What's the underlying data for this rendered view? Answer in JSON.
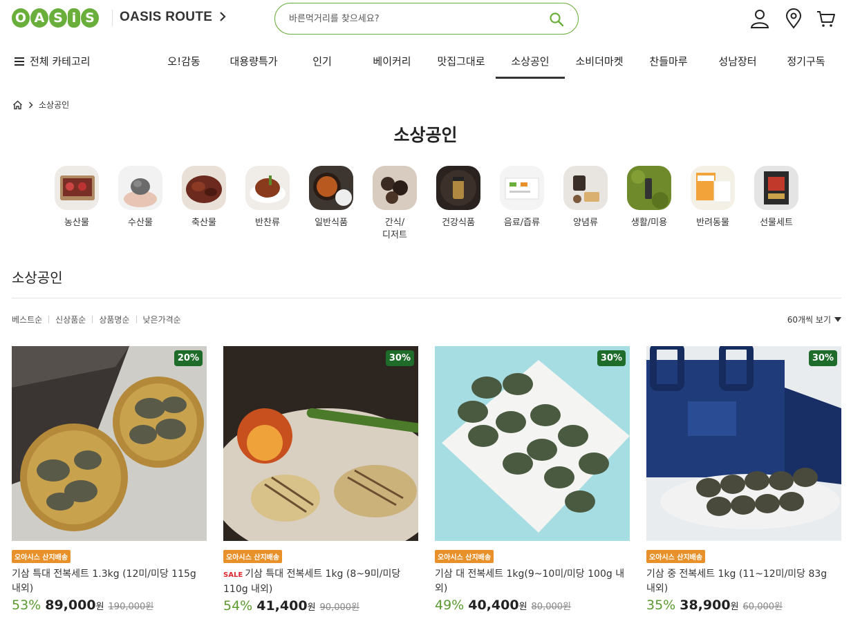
{
  "header": {
    "logo_letters": [
      "O",
      "A",
      "S",
      "i",
      "S"
    ],
    "route_label": "OASIS ROUTE",
    "search_placeholder": "바른먹거리를 찾으세요?"
  },
  "colors": {
    "brand_green": "#6aae3c",
    "badge_green": "#1e6b2a",
    "ship_orange": "#e8912a",
    "sale_red": "#e0262e"
  },
  "nav": {
    "all_categories": "전체 카테고리",
    "items": [
      "오!감동",
      "대용량특가",
      "인기",
      "베이커리",
      "맛집그대로",
      "소상공인",
      "소비더마켓",
      "찬들마루",
      "성남장터",
      "정기구독"
    ],
    "active": "소상공인"
  },
  "breadcrumb": {
    "current": "소상공인"
  },
  "page_title": "소상공인",
  "categories": [
    "농산물",
    "수산물",
    "축산물",
    "반찬류",
    "일반식품",
    "간식/\n디저트",
    "건강식품",
    "음료/즙류",
    "양념류",
    "생활/미용",
    "반려동물",
    "선물세트"
  ],
  "section_title": "소상공인",
  "sorts": [
    "베스트순",
    "신상품순",
    "상품명순",
    "낮은가격순"
  ],
  "per_page": "60개씩 보기",
  "products": [
    {
      "badge": "20%",
      "ship": "오아시스 산지배송",
      "sale": "",
      "name": "기삼 특대 전복세트 1.3kg (12미/미당 115g 내외)",
      "rate": "53%",
      "price": "89,000",
      "won": "원",
      "orig": "190,000원"
    },
    {
      "badge": "30%",
      "ship": "오아시스 산지배송",
      "sale": "SALE",
      "name": "기삼 특대 전복세트 1kg (8~9미/미당 110g 내외)",
      "rate": "54%",
      "price": "41,400",
      "won": "원",
      "orig": "90,000원"
    },
    {
      "badge": "30%",
      "ship": "오아시스 산지배송",
      "sale": "",
      "name": "기삼 대 전복세트 1kg(9~10미/미당 100g 내외)",
      "rate": "49%",
      "price": "40,400",
      "won": "원",
      "orig": "80,000원"
    },
    {
      "badge": "30%",
      "ship": "오아시스 산지배송",
      "sale": "",
      "name": "기삼 중 전복세트 1kg (11~12미/미당 83g 내외)",
      "rate": "35%",
      "price": "38,900",
      "won": "원",
      "orig": "60,000원"
    }
  ]
}
